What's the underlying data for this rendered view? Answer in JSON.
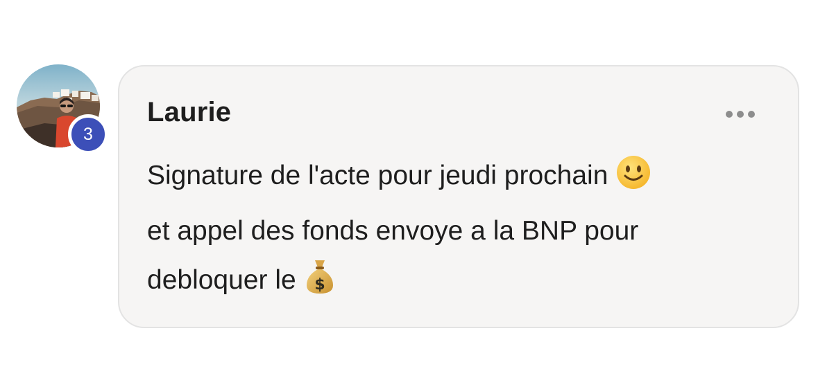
{
  "comment": {
    "author": "Laurie",
    "badge_count": "3",
    "message_lines": [
      {
        "text": "Signature de l'acte pour jeudi prochain",
        "emoji": "smiling-face-icon"
      },
      {
        "text": "et appel des fonds envoye a la BNP pour",
        "emoji": ""
      },
      {
        "text": "debloquer le",
        "emoji": "money-bag-icon"
      }
    ]
  },
  "colors": {
    "badge": "#3c4fb8",
    "bubble_background": "#f6f5f4",
    "text": "#1e1e1e"
  }
}
